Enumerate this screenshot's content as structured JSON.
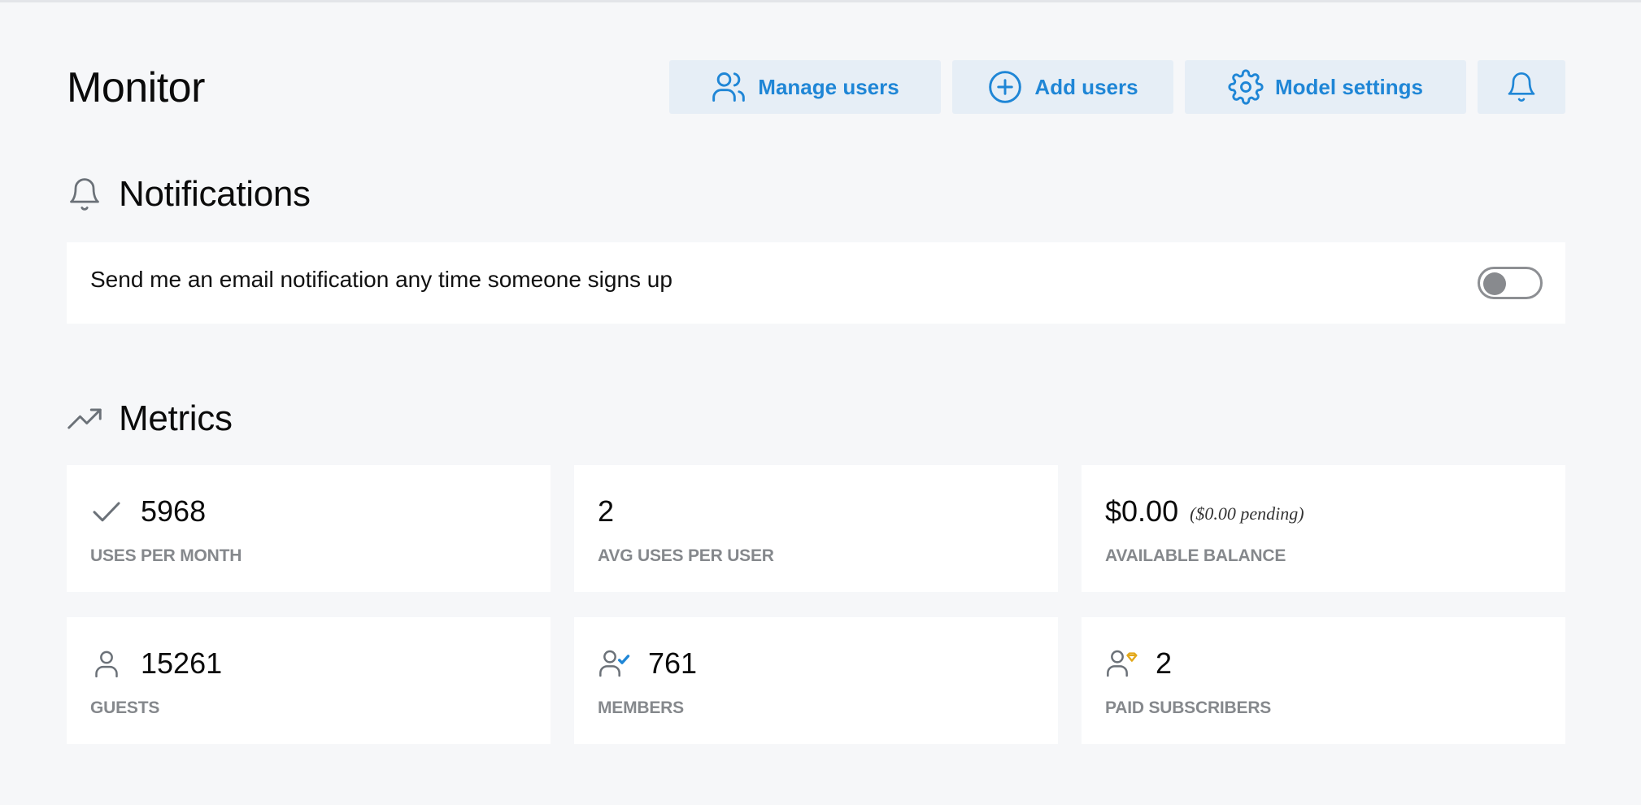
{
  "header": {
    "title": "Monitor",
    "actions": {
      "manage_users": "Manage users",
      "add_users": "Add users",
      "model_settings": "Model settings"
    }
  },
  "notifications": {
    "title": "Notifications",
    "email_signup_text": "Send me an email notification any time someone signs up",
    "email_signup_enabled": false
  },
  "metrics": {
    "title": "Metrics",
    "cards": [
      {
        "value": "5968",
        "label": "USES PER MONTH",
        "icon": "check-icon"
      },
      {
        "value": "2",
        "label": "AVG USES PER USER"
      },
      {
        "value": "$0.00",
        "pending": "($0.00 pending)",
        "label": "AVAILABLE BALANCE"
      },
      {
        "value": "15261",
        "label": "GUESTS",
        "icon": "user-icon"
      },
      {
        "value": "761",
        "label": "MEMBERS",
        "icon": "user-check-icon"
      },
      {
        "value": "2",
        "label": "PAID SUBSCRIBERS",
        "icon": "user-diamond-icon"
      }
    ]
  },
  "colors": {
    "accent": "#1f86d6",
    "button_bg": "#e6eef6",
    "page_bg": "#f6f7f9",
    "label_gray": "#85888c",
    "icon_gray": "#6b7178",
    "gold": "#e3a81a"
  }
}
